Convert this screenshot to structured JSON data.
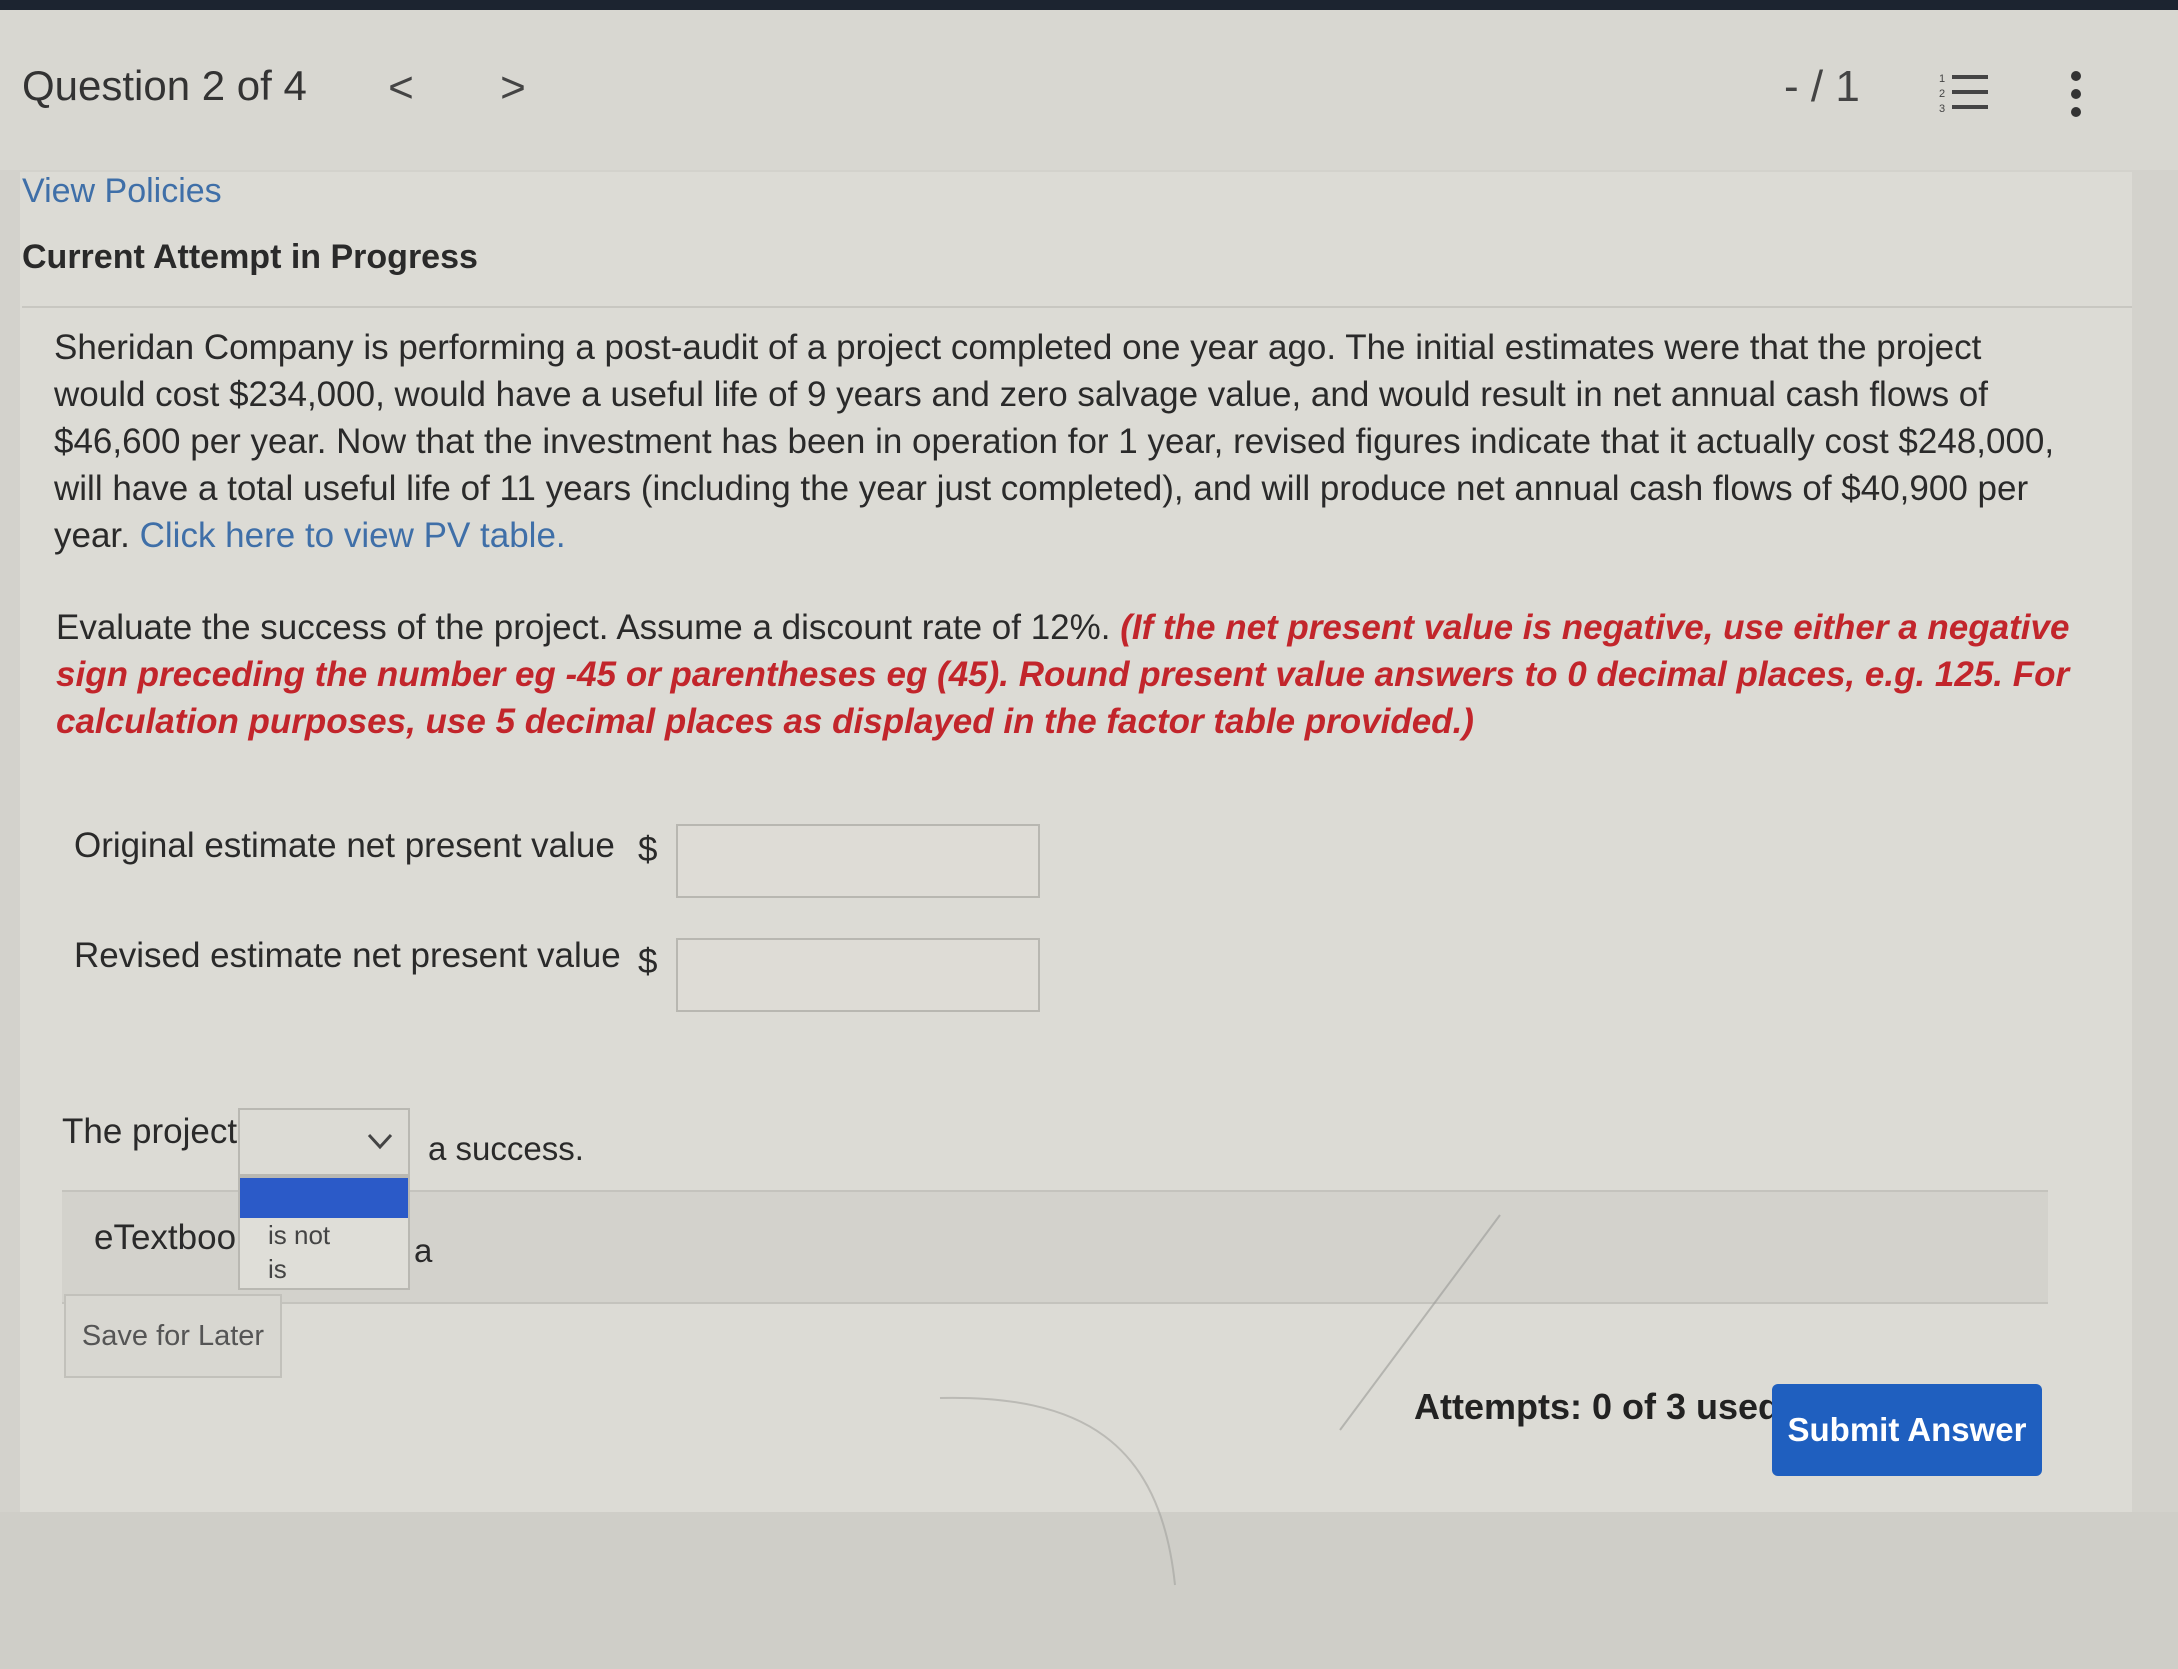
{
  "header": {
    "question_label": "Question 2 of 4",
    "prev_glyph": "<",
    "next_glyph": ">",
    "score": "- / 1"
  },
  "links": {
    "view_policies": "View Policies"
  },
  "status": {
    "attempt_label": "Current Attempt in Progress"
  },
  "question": {
    "body": "Sheridan Company is performing a post-audit of a project completed one year ago. The initial estimates were that the project would cost $234,000, would have a useful life of 9 years and zero salvage value, and would result in net annual cash flows of $46,600 per year. Now that the investment has been in operation for 1 year, revised figures indicate that it actually cost $248,000, will have a total useful life of 11 years (including the year just completed), and will produce net annual cash flows of $40,900 per year.",
    "pv_link": "Click here to view PV table.",
    "instruction": "Evaluate the success of the project. Assume a discount rate of 12%.",
    "instruction_note": "(If the net present value is negative, use either a negative sign preceding the number eg -45 or parentheses eg (45). Round present value answers to 0 decimal places, e.g. 125. For calculation purposes, use 5 decimal places as displayed in the factor table provided.)"
  },
  "answers": {
    "original_label": "Original estimate net present value",
    "revised_label": "Revised estimate net present value",
    "currency": "$",
    "original_value": "",
    "revised_value": ""
  },
  "project": {
    "label": "The project",
    "selected": "",
    "suffix": "a success.",
    "options": [
      "",
      "is not",
      "is"
    ]
  },
  "etextbook": {
    "label": "eTextboo",
    "tail": "a"
  },
  "footer": {
    "save_label": "Save for Later",
    "attempts": "Attempts: 0 of 3 used",
    "submit_label": "Submit Answer"
  },
  "colors": {
    "link": "#3f6fa8",
    "note_red": "#c2252b",
    "submit_blue": "#1f5fbf",
    "dropdown_highlight": "#2b5ac8"
  },
  "icons": [
    "chevron-left-icon",
    "chevron-right-icon",
    "numbered-list-icon",
    "more-vertical-icon",
    "chevron-down-icon"
  ]
}
